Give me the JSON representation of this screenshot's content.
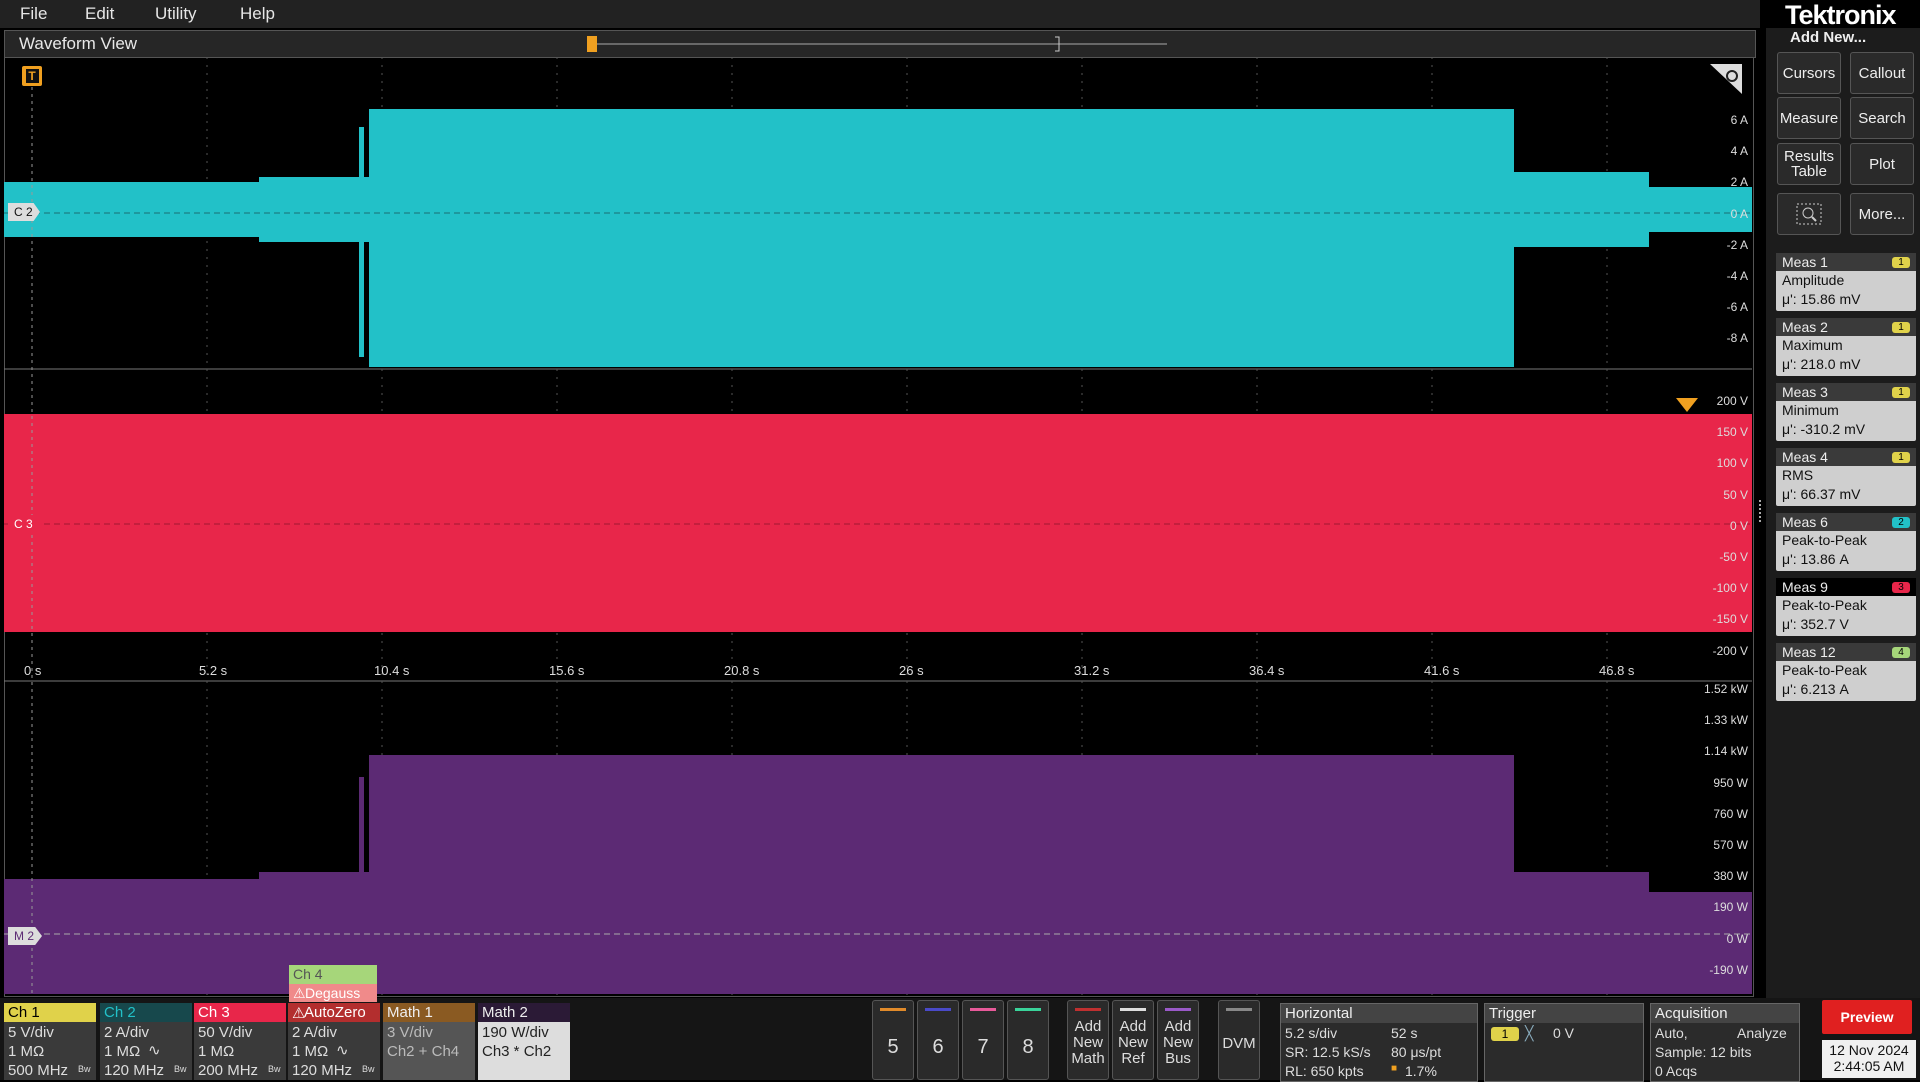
{
  "menu": {
    "file": "File",
    "edit": "Edit",
    "utility": "Utility",
    "help": "Help"
  },
  "brand": "Tektronix",
  "waveform_view": {
    "title": "Waveform View"
  },
  "trigger_marker": "T",
  "channel_markers": {
    "c2": "C 2",
    "c3": "C 3",
    "m2": "M 2"
  },
  "ch2_axis": [
    "6 A",
    "4 A",
    "2 A",
    "0 A",
    "-2 A",
    "-4 A",
    "-6 A",
    "-8 A"
  ],
  "ch3_axis": [
    "200 V",
    "150 V",
    "100 V",
    "50 V",
    "0 V",
    "-50 V",
    "-100 V",
    "-150 V",
    "-200 V"
  ],
  "math_axis": [
    "1.52 kW",
    "1.33 kW",
    "1.14 kW",
    "950 W",
    "760 W",
    "570 W",
    "380 W",
    "190 W",
    "0 W",
    "-190 W"
  ],
  "time_axis": [
    "0 s",
    "5.2 s",
    "10.4 s",
    "15.6 s",
    "20.8 s",
    "26 s",
    "31.2 s",
    "36.4 s",
    "41.6 s",
    "46.8 s"
  ],
  "colors": {
    "ch1": "#e0d24a",
    "ch2": "#22c1c8",
    "ch3": "#e8264a",
    "ch4": "#a6d67a",
    "math1": "#d88a2e",
    "math2_wave": "#5c2a74",
    "preview": "#e02020"
  },
  "right_panel": {
    "add_new": "Add New...",
    "cursors": "Cursors",
    "callout": "Callout",
    "measure": "Measure",
    "search": "Search",
    "results_table_1": "Results",
    "results_table_2": "Table",
    "plot": "Plot",
    "more": "More..."
  },
  "measurements": [
    {
      "name": "Meas 1",
      "type": "Amplitude",
      "value": "μ': 15.86 mV",
      "badge": "1",
      "color": "#e0d24a"
    },
    {
      "name": "Meas 2",
      "type": "Maximum",
      "value": "μ': 218.0 mV",
      "badge": "1",
      "color": "#e0d24a"
    },
    {
      "name": "Meas 3",
      "type": "Minimum",
      "value": "μ': -310.2 mV",
      "badge": "1",
      "color": "#e0d24a"
    },
    {
      "name": "Meas 4",
      "type": "RMS",
      "value": "μ': 66.37 mV",
      "badge": "1",
      "color": "#e0d24a"
    },
    {
      "name": "Meas 6",
      "type": "Peak-to-Peak",
      "value": "μ': 13.86 A",
      "badge": "2",
      "color": "#22c1c8"
    },
    {
      "name": "Meas 9",
      "type": "Peak-to-Peak",
      "value": "μ': 352.7 V",
      "badge": "3",
      "color": "#e8264a"
    },
    {
      "name": "Meas 12",
      "type": "Peak-to-Peak",
      "value": "μ': 6.213 A",
      "badge": "4",
      "color": "#a6d67a"
    }
  ],
  "channels": {
    "ch1": {
      "name": "Ch 1",
      "l1": "5 V/div",
      "l2": "1 MΩ",
      "l3": "500 MHz"
    },
    "ch2": {
      "name": "Ch 2",
      "l1": "2 A/div",
      "l2": "1 MΩ",
      "l3": "120 MHz"
    },
    "ch3": {
      "name": "Ch 3",
      "l1": "50 V/div",
      "l2": "1 MΩ",
      "l3": "200 MHz"
    },
    "ch4": {
      "name": "Ch 4",
      "degauss": "Degauss",
      "autozero": "AutoZero",
      "l1": "2 A/div",
      "l2": "1 MΩ",
      "l3": "120 MHz"
    },
    "math1": {
      "name": "Math 1",
      "l1": "3 V/div",
      "l2": "Ch2 + Ch4"
    },
    "math2": {
      "name": "Math 2",
      "l1": "190 W/div",
      "l2": "Ch3 * Ch2"
    }
  },
  "bw_mark": "Bw",
  "num_buttons": [
    "5",
    "6",
    "7",
    "8"
  ],
  "add_buttons": {
    "math": [
      "Add",
      "New",
      "Math"
    ],
    "ref": [
      "Add",
      "New",
      "Ref"
    ],
    "bus": [
      "Add",
      "New",
      "Bus"
    ]
  },
  "dvm": "DVM",
  "horizontal": {
    "title": "Horizontal",
    "scale": "5.2 s/div",
    "duration": "52 s",
    "sr": "SR: 12.5 kS/s",
    "pt": "80 μs/pt",
    "rl": "RL: 650 kpts",
    "pos": "1.7%"
  },
  "trigger": {
    "title": "Trigger",
    "source": "1",
    "level": "0 V"
  },
  "acquisition": {
    "title": "Acquisition",
    "mode": "Auto,",
    "analyze": "Analyze",
    "sample": "Sample: 12 bits",
    "acqs": "0 Acqs"
  },
  "preview": "Preview",
  "datetime": {
    "date": "12 Nov 2024",
    "time": "2:44:05 AM"
  }
}
